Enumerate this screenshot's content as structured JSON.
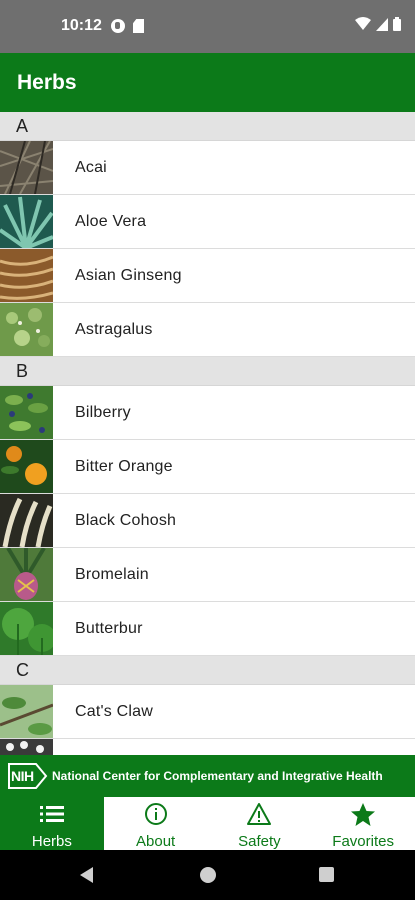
{
  "status_bar": {
    "time": "10:12"
  },
  "app_bar": {
    "title": "Herbs"
  },
  "sections": [
    {
      "letter": "A",
      "herbs": [
        "Acai",
        "Aloe Vera",
        "Asian Ginseng",
        "Astragalus"
      ]
    },
    {
      "letter": "B",
      "herbs": [
        "Bilberry",
        "Bitter Orange",
        "Black Cohosh",
        "Bromelain",
        "Butterbur"
      ]
    },
    {
      "letter": "C",
      "herbs": [
        "Cat's Claw"
      ]
    }
  ],
  "banner": {
    "logo_text": "NIH",
    "org_name": "National Center for Complementary and Integrative Health"
  },
  "bottom_nav": [
    {
      "label": "Herbs",
      "icon": "list-icon",
      "active": true
    },
    {
      "label": "About",
      "icon": "info-icon",
      "active": false
    },
    {
      "label": "Safety",
      "icon": "warning-icon",
      "active": false
    },
    {
      "label": "Favorites",
      "icon": "star-icon",
      "active": false
    }
  ],
  "colors": {
    "brand_green": "#0c7a19",
    "section_bg": "#e3e3e3",
    "status_bar": "#6f6f6f"
  }
}
